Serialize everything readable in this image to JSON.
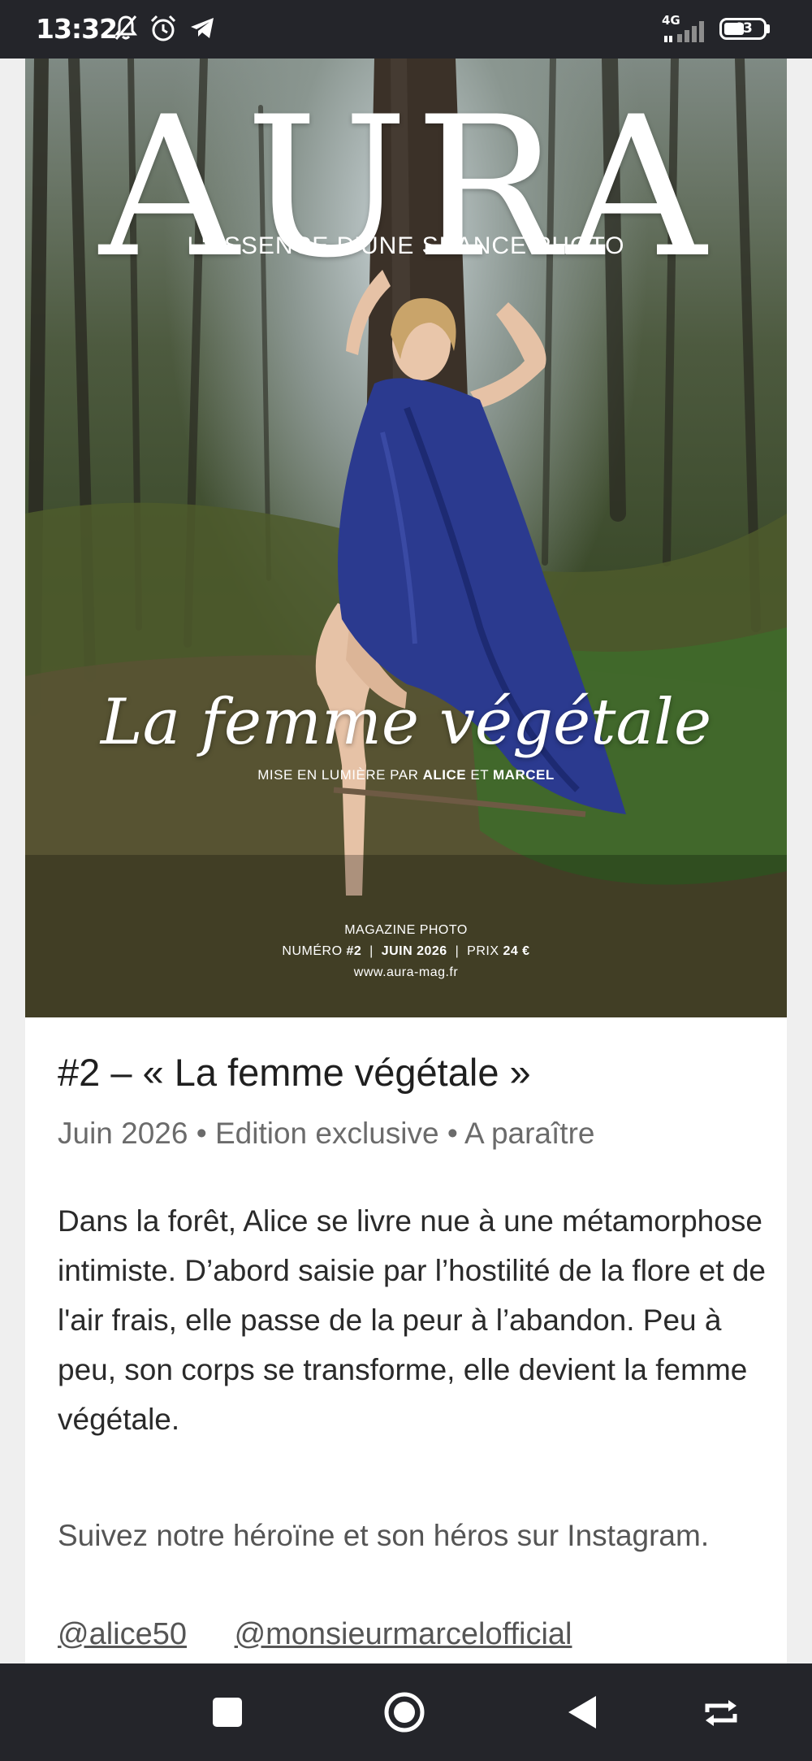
{
  "status_bar": {
    "time": "13:32",
    "network": "4G",
    "battery": "43"
  },
  "cover": {
    "brand": "AURA",
    "tagline": "L'ESSENCE D'UNE SÉANCE PHOTO",
    "title": "La femme végétale",
    "credit_prefix": "MISE EN LUMIÈRE PAR",
    "credit_name1": "ALICE",
    "credit_and": "ET",
    "credit_name2": "MARCEL",
    "footer_line1": "MAGAZINE PHOTO",
    "numero_label": "NUMÉRO",
    "numero_value": "#2",
    "date": "JUIN 2026",
    "prix_label": "PRIX",
    "prix_value": "24 €",
    "website": "www.aura-mag.fr"
  },
  "issue": {
    "title": "#2 – « La femme végétale »",
    "meta": "Juin 2026 • Edition exclusive • A paraître",
    "description": "Dans la forêt, Alice se livre nue à une métamorphose intimiste. D’abord saisie par l’hostilité de la flore et de l'air frais, elle passe de la peur à l’abandon. Peu à peu, son corps se transforme, elle devient la femme végétale.",
    "follow_text": "Suivez notre héroïne et son héros sur Instagram.",
    "link1": "@alice50",
    "link2": "@monsieurmarcelofficial"
  },
  "nav_icons": [
    "recents-square-icon",
    "home-circle-icon",
    "back-triangle-icon",
    "rotate-icon"
  ],
  "colors": {
    "bar_bg": "#24252a",
    "fabric_blue": "#2b3a8f",
    "page_bg": "#efefef"
  }
}
